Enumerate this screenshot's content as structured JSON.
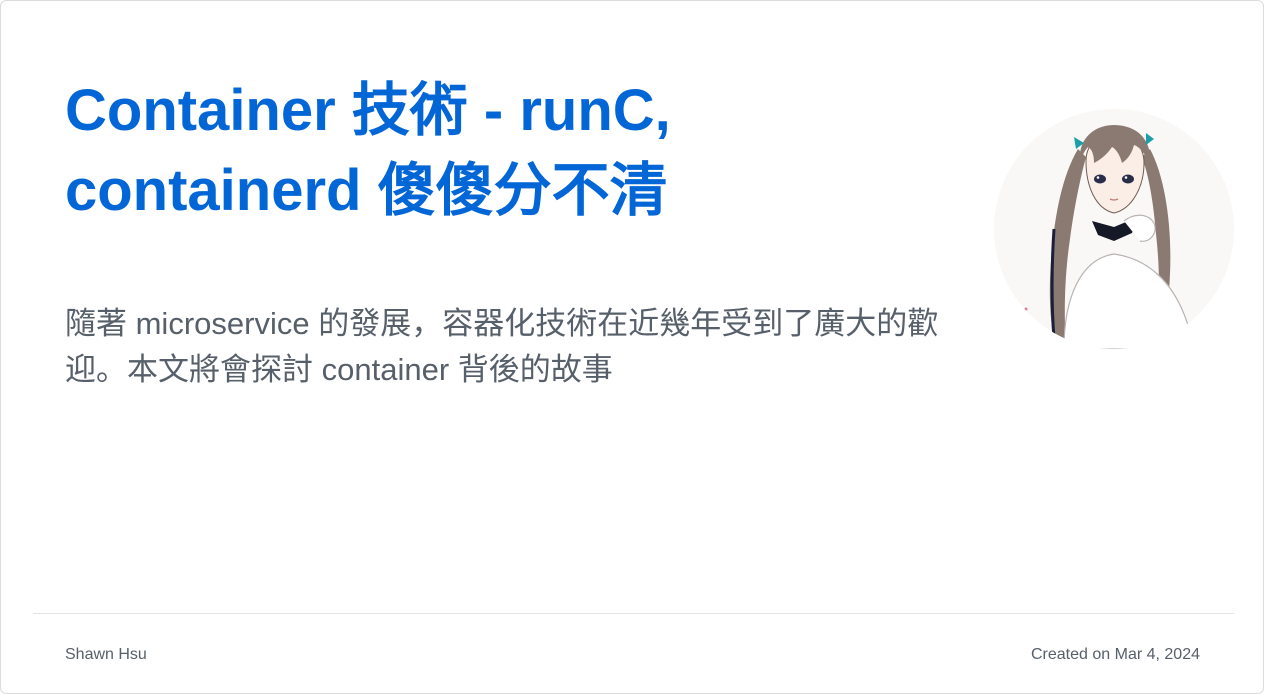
{
  "post": {
    "title": "Container 技術 - runC, containerd 傻傻分不清",
    "description": "隨著 microservice 的發展，容器化技術在近幾年受到了廣大的歡迎。本文將會探討 container 背後的故事",
    "author": "Shawn Hsu",
    "created": "Created on Mar 4, 2024"
  },
  "avatar": {
    "icon": "anime-girl-avatar"
  },
  "colors": {
    "title": "#0366d6",
    "text": "#57606a",
    "divider": "#e1e4e8",
    "card_border": "#dcdcdc"
  }
}
